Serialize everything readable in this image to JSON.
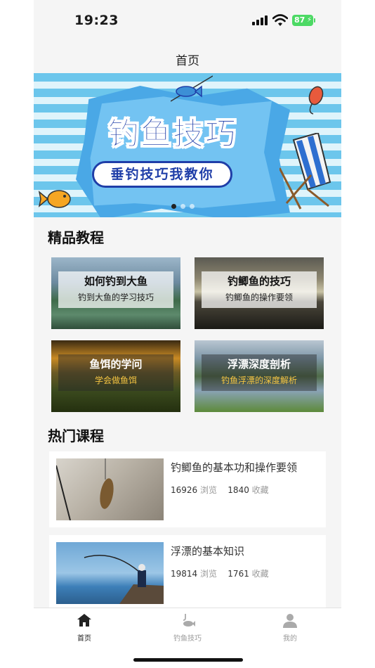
{
  "status": {
    "time": "19:23",
    "battery": "87"
  },
  "nav": {
    "title": "首页"
  },
  "banner": {
    "headline": "钓鱼技巧",
    "subline": "垂钓技巧我教你",
    "slides": 3,
    "active_slide": 1
  },
  "premium": {
    "title": "精品教程",
    "items": [
      {
        "title": "如何钓到大鱼",
        "subtitle": "钓到大鱼的学习技巧"
      },
      {
        "title": "钓鲫鱼的技巧",
        "subtitle": "钓鲫鱼的操作要领"
      },
      {
        "title": "鱼饵的学问",
        "subtitle": "学会做鱼饵"
      },
      {
        "title": "浮漂深度剖析",
        "subtitle": "钓鱼浮漂的深度解析"
      }
    ]
  },
  "hot": {
    "title": "热门课程",
    "view_label": "浏览",
    "fav_label": "收藏",
    "items": [
      {
        "title": "钓鲫鱼的基本功和操作要领",
        "views": "16926",
        "favorites": "1840"
      },
      {
        "title": "浮漂的基本知识",
        "views": "19814",
        "favorites": "1761"
      }
    ]
  },
  "tabs": [
    {
      "label": "首页",
      "icon": "home-icon",
      "active": true
    },
    {
      "label": "钓鱼技巧",
      "icon": "fishing-icon",
      "active": false
    },
    {
      "label": "我的",
      "icon": "user-icon",
      "active": false
    }
  ],
  "colors": {
    "accent": "#1f3ea8",
    "battery": "#4cd964",
    "highlight": "#f5c542"
  }
}
